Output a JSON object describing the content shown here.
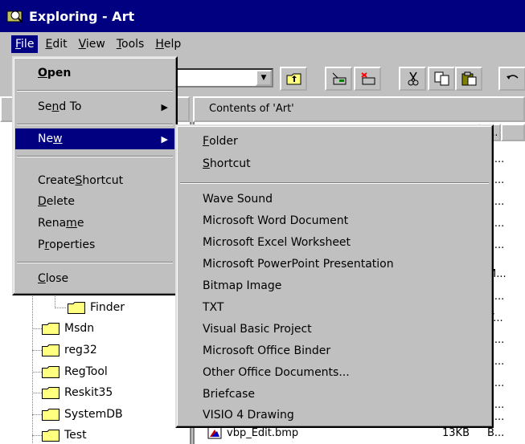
{
  "window": {
    "title": "Exploring - Art"
  },
  "menubar": {
    "items": [
      "File",
      "Edit",
      "View",
      "Tools",
      "Help"
    ]
  },
  "contents_header": "Contents of 'Art'",
  "file_menu": {
    "open": "Open",
    "send_to": "Send To",
    "new": "New",
    "create_shortcut": "Create Shortcut",
    "delete": "Delete",
    "rename": "Rename",
    "properties": "Properties",
    "close": "Close"
  },
  "new_menu": {
    "folder": "Folder",
    "shortcut": "Shortcut",
    "items": [
      "Wave Sound",
      "Microsoft Word Document",
      "Microsoft Excel Worksheet",
      "Microsoft PowerPoint Presentation",
      "Bitmap Image",
      "TXT",
      "Visual Basic Project",
      "Microsoft Office Binder",
      "Other Office Documents...",
      "Briefcase",
      "VISIO 4 Drawing"
    ]
  },
  "tree": {
    "items": [
      "Finder",
      "Msdn",
      "reg32",
      "RegTool",
      "Reskit35",
      "SystemDB",
      "Test"
    ]
  },
  "right_pane": {
    "column_partial": "T...",
    "type_cells": [
      "B...",
      "B...",
      "B...",
      "B...",
      "B...",
      "M...",
      "B...",
      "V...",
      "B...",
      "B...",
      "B...",
      "B...",
      "B...",
      "B..."
    ],
    "visible_file": {
      "name": "vbp_Edit.bmp",
      "size": "13KB",
      "type": "B..."
    }
  },
  "colors": {
    "titlebar": "#000080",
    "highlight": "#000080",
    "face": "#c0c0c0"
  }
}
